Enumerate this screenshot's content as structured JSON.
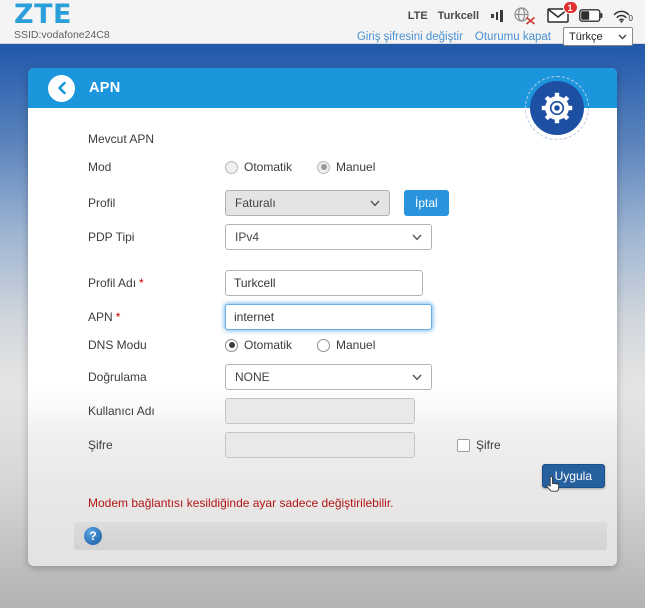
{
  "header": {
    "logo": "ZTE",
    "ssid": "SSID:vodafone24C8",
    "network_tech": "LTE",
    "carrier": "Turkcell",
    "message_badge": "1",
    "wifi_count": "0",
    "links": {
      "change_password": "Giriş şifresini değiştir",
      "logout": "Oturumu kapat"
    },
    "language": "Türkçe"
  },
  "panel": {
    "title": "APN",
    "form": {
      "current_apn": {
        "label": "Mevcut APN",
        "value": ""
      },
      "mode": {
        "label": "Mod",
        "options": [
          "Otomatik",
          "Manuel"
        ],
        "selected": "Manuel"
      },
      "profile": {
        "label": "Profil",
        "value": "Faturalı",
        "cancel_button": "İptal"
      },
      "pdp": {
        "label": "PDP Tipi",
        "value": "IPv4"
      },
      "profile_name": {
        "label": "Profil Adı",
        "required": "*",
        "value": "Turkcell"
      },
      "apn": {
        "label": "APN",
        "required": "*",
        "value": "internet"
      },
      "dns": {
        "label": "DNS Modu",
        "options": [
          "Otomatik",
          "Manuel"
        ],
        "selected": "Otomatik"
      },
      "auth": {
        "label": "Doğrulama",
        "value": "NONE"
      },
      "username": {
        "label": "Kullanıcı Adı",
        "value": ""
      },
      "password": {
        "label": "Şifre",
        "value": "",
        "checkbox_label": "Şifre"
      },
      "apply_button": "Uygula",
      "warning": "Modem bağlantısı kesildiğinde ayar sadece değiştirilebilir.",
      "help": "?"
    }
  },
  "colors": {
    "header_blue": "#1b96dd",
    "gear_blue": "#1d4fa3",
    "apply_blue": "#27609f",
    "iptal_blue": "#2a93dd",
    "link_blue": "#4a90d0",
    "logo_blue": "#2b9fda",
    "warning_red": "#b01616",
    "badge_red": "#e03131"
  }
}
